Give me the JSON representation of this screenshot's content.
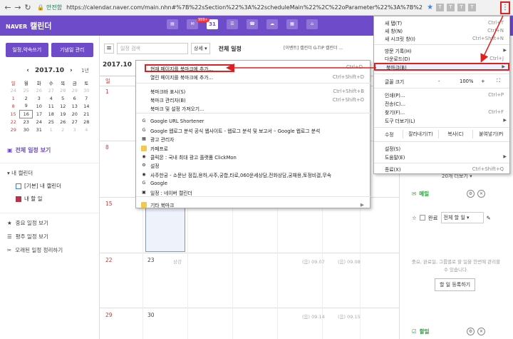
{
  "browser": {
    "secure_label": "안전함",
    "url": "https://calendar.naver.com/main.nhn#%7B%22sSection%22%3A%22scheduleMain%22%2C%22oParameter%22%3A%7B%22sViewType%22%3A%22...",
    "menu_icon": "kebab-icon"
  },
  "header": {
    "brand_small": "NAVER",
    "brand": "캘린더",
    "mail_badge": "999+",
    "calendar_day": "31",
    "accent": "#6e4bc8"
  },
  "sidebar": {
    "btn_schedule": "일정,약속쓰기",
    "btn_anniversary": "기념일 관리",
    "mini_month": "2017.10",
    "mini_prev": "‹",
    "mini_next": "›",
    "year_link": "1년",
    "weekdays": [
      "일",
      "월",
      "화",
      "수",
      "목",
      "금",
      "토"
    ],
    "weeks": [
      [
        "24",
        "25",
        "26",
        "27",
        "28",
        "29",
        "30"
      ],
      [
        "1",
        "2",
        "3",
        "4",
        "5",
        "6",
        "7"
      ],
      [
        "8",
        "9",
        "10",
        "11",
        "12",
        "13",
        "14"
      ],
      [
        "15",
        "16",
        "17",
        "18",
        "19",
        "20",
        "21"
      ],
      [
        "22",
        "23",
        "24",
        "25",
        "26",
        "27",
        "28"
      ],
      [
        "29",
        "30",
        "31",
        "1",
        "2",
        "3",
        "4"
      ]
    ],
    "all_view": "전체 일정 보기",
    "my_cal_title": "내 캘린더",
    "cal_default": "[기본] 내 캘린더",
    "cal_todo": "내 할 일",
    "link_important": "중요 일정 보기",
    "link_weekly": "평주 일정 보기",
    "link_cleanup": "오래된 일정 정리하기"
  },
  "toolbar": {
    "search_placeholder": "일정 검색",
    "search_select": "상세",
    "tab_all": "전체 일정",
    "banner": "[이벤트] 캘린더 G-TIP 캘린더 ..."
  },
  "grid": {
    "month": "2017.10",
    "sunday_label": "일",
    "dates": {
      "r1": "1",
      "r2": "8",
      "r3": "15",
      "r4_a": "22",
      "r4_b": "23",
      "r4_b_sub": "상강",
      "r4_c": "(음) 09.07",
      "r4_d": "(음) 09.08",
      "r5_a": "29",
      "r5_b": "30",
      "r5_c": "(음) 09.14",
      "r5_d": "(음) 09.15"
    }
  },
  "right_panel": {
    "more": "20개 더보기 ▾",
    "mail": "메일",
    "done": "완료",
    "filter": "전체 할 일",
    "empty": "중요, 완료일, 그룹별로 할 일을 한번에 관리할 수 있습니다.",
    "add_btn": "할 일 등록하기",
    "todo": "할일"
  },
  "bookmark_submenu": {
    "items": [
      {
        "label": "현재 페이지를 북마크에 추가...",
        "short": "Ctrl+D"
      },
      {
        "label": "열린 페이지를 북마크에 추가...",
        "short": "Ctrl+Shift+D"
      },
      {
        "label": "북마크바 표시(S)",
        "short": "Ctrl+Shift+B"
      },
      {
        "label": "북마크 관리자(B)",
        "short": "Ctrl+Shift+O"
      },
      {
        "label": "북마크 및 설정 가져오기...",
        "short": ""
      },
      {
        "label": "Google URL Shortener",
        "short": ""
      },
      {
        "label": "Google 웹로그 분석 공식 웹사이트 - 웹로그 분석 및 보고서 – Google 웹로그 분석",
        "short": ""
      },
      {
        "label": "광고 관리자",
        "short": ""
      },
      {
        "label": "카페프로",
        "short": ""
      },
      {
        "label": "클릭몬 : 국내 최대 광고 플랫폼 ClickMon",
        "short": ""
      },
      {
        "label": "설정",
        "short": ""
      },
      {
        "label": "사주한궁 - 소문난 점집,용하,사주,궁합,타로,060운세상담,전화상담,궁채용,토정비결,무속",
        "short": ""
      },
      {
        "label": "Google",
        "short": ""
      },
      {
        "label": "일정 : 네이버 캘린더",
        "short": ""
      },
      {
        "label": "기타 북마크",
        "short": ""
      }
    ]
  },
  "main_menu": {
    "new_tab": {
      "label": "새 탭(T)",
      "short": "Ctrl+T"
    },
    "new_window": {
      "label": "새 창(N)",
      "short": "Ctrl+N"
    },
    "incognito": {
      "label": "새 시크릿 창(I)",
      "short": "Ctrl+Shift+N"
    },
    "history": {
      "label": "방문 기록(H)",
      "short": ""
    },
    "downloads": {
      "label": "다운로드(D)",
      "short": "Ctrl+J"
    },
    "bookmarks": {
      "label": "북마크(B)",
      "short": ""
    },
    "zoom": {
      "label": "글꼴 크기",
      "minus": "-",
      "value": "100%",
      "plus": "+",
      "full": "⛶"
    },
    "print": {
      "label": "인쇄(P)...",
      "short": "Ctrl+P"
    },
    "cast": {
      "label": "전송(C)...",
      "short": ""
    },
    "find": {
      "label": "찾기(F)...",
      "short": "Ctrl+F"
    },
    "tools": {
      "label": "도구 더보기(L)",
      "short": ""
    },
    "edit": {
      "label": "수정",
      "cut": "잘라내기(T)",
      "copy": "복사(C)",
      "paste": "붙여넣기(P)"
    },
    "settings": {
      "label": "설정(S)",
      "short": ""
    },
    "help": {
      "label": "도움말(E)",
      "short": ""
    },
    "exit": {
      "label": "종료(X)",
      "short": "Ctrl+Shift+Q"
    }
  }
}
